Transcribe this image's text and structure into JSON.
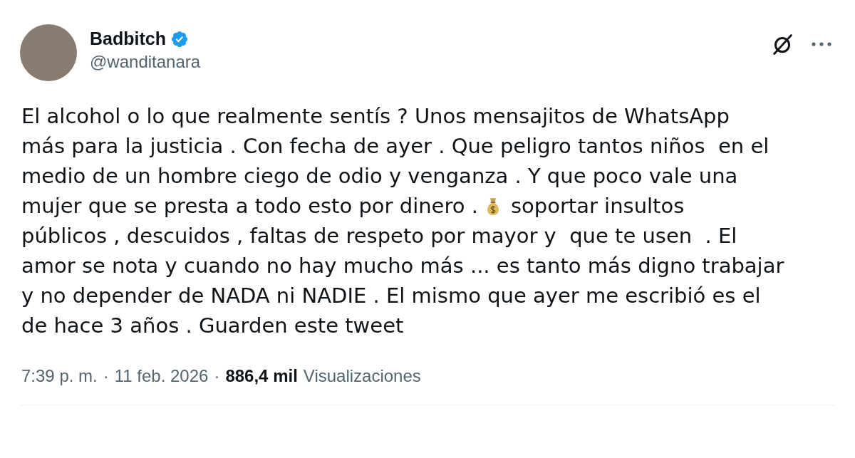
{
  "author": {
    "name": "Badbitch",
    "verified": true,
    "handle": "@wanditanara"
  },
  "tweet": {
    "lines": [
      {
        "segments": [
          {
            "kind": "text",
            "text": "El alcohol o lo que realmente sentís ? Unos mensajitos de WhatsApp"
          }
        ]
      },
      {
        "segments": [
          {
            "kind": "text",
            "text": "más para la justicia . Con fecha de ayer . Que peligro tantos niños  en el"
          }
        ]
      },
      {
        "segments": [
          {
            "kind": "text",
            "text": "medio de un hombre ciego de odio y venganza . Y que poco vale una"
          }
        ]
      },
      {
        "segments": [
          {
            "kind": "text",
            "text": "mujer que se presta a todo esto por dinero ."
          },
          {
            "kind": "money_bag"
          },
          {
            "kind": "text",
            "text": "soportar insultos"
          }
        ]
      },
      {
        "segments": [
          {
            "kind": "text",
            "text": "públicos , descuidos , faltas de respeto por mayor y  que te usen  . El"
          }
        ]
      },
      {
        "segments": [
          {
            "kind": "text",
            "text": "amor se nota y cuando no hay mucho más ... es tanto más digno trabajar"
          }
        ]
      },
      {
        "segments": [
          {
            "kind": "text",
            "text": "y no depender de NADA ni NADIE . El mismo que ayer me escribió es el"
          }
        ]
      },
      {
        "segments": [
          {
            "kind": "text",
            "text": "de hace 3 años . Guarden este tweet"
          }
        ]
      }
    ]
  },
  "meta": {
    "time": "7:39 p. m.",
    "separator": "·",
    "date": "11 feb. 2026",
    "separator_2": "·",
    "views_count": "886,4 mil",
    "views_label": "Visualizaciones"
  }
}
